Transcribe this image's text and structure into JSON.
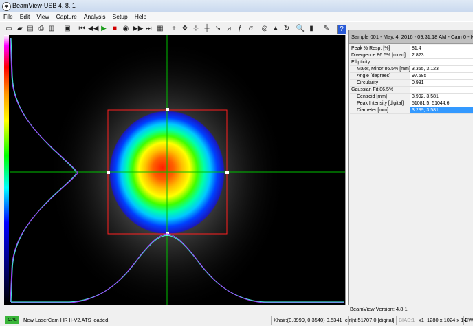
{
  "window": {
    "title": "BeamView-USB 4. 8. 1"
  },
  "menu": [
    "File",
    "Edit",
    "View",
    "Capture",
    "Analysis",
    "Setup",
    "Help"
  ],
  "toolbar": {
    "icons": [
      "new-icon",
      "open-icon",
      "save-icon",
      "print-icon",
      "print-preview-icon",
      "camera-icon",
      "first-frame-icon",
      "previous-frame-icon",
      "play-icon",
      "stop-icon",
      "record-icon",
      "next-frame-icon",
      "last-frame-icon",
      "snapshot-icon",
      "crosshair-icon",
      "move-crosshair-icon",
      "axis-icon",
      "cursor-icon",
      "angle-icon",
      "profile-icon",
      "function-icon",
      "sigma-icon",
      "aperture-icon",
      "3d-view-icon",
      "rotate-icon",
      "zoom-icon",
      "histogram-icon",
      "pen-icon",
      "help-icon"
    ],
    "glyphs": [
      "▭",
      "▰",
      "▤",
      "⎙",
      "▥",
      "▣",
      "⏮",
      "◀◀",
      "▶",
      "■",
      "◉",
      "▶▶",
      "⏭",
      "▦",
      "+",
      "✥",
      "⊹",
      "┼",
      "↘",
      "⩘",
      "ƒ",
      "σ",
      "◎",
      "▲",
      "↻",
      "🔍",
      "▮",
      "✎",
      "?"
    ]
  },
  "colors": {
    "accent": "#3399ff",
    "cal_green": "#3ab53a",
    "crosshair": "#00c000",
    "roi_box": "#ff2020",
    "profile_fit": "#a040ff",
    "profile_data": "#40e0d0"
  },
  "panel": {
    "header": "Sample 001 - May. 4, 2016 - 09:31:18 AM - Cam 0 - N",
    "rows": [
      {
        "label": "Peak % Resp. [%]",
        "value": "81.4",
        "indent": 0,
        "selected": false
      },
      {
        "label": "Divergence 86.5% [mrad]",
        "value": "2.823",
        "indent": 0,
        "selected": false
      },
      {
        "label": "Ellipticity",
        "value": "",
        "indent": 0,
        "selected": false
      },
      {
        "label": "Major, Minor 86.5% [mm]",
        "value": "3.355, 3.123",
        "indent": 1,
        "selected": false
      },
      {
        "label": "Angle [degrees]",
        "value": "97.585",
        "indent": 1,
        "selected": false
      },
      {
        "label": "Circularity",
        "value": "0.931",
        "indent": 1,
        "selected": false
      },
      {
        "label": "Gaussian Fit 86.5%",
        "value": "",
        "indent": 0,
        "selected": false
      },
      {
        "label": "Centroid [mm]",
        "value": "3.992, 3.581",
        "indent": 1,
        "selected": false
      },
      {
        "label": "Peak Intensity [digital]",
        "value": "51081.5, 51044.6",
        "indent": 1,
        "selected": false
      },
      {
        "label": "Diameter [mm]",
        "value": "3.239, 3.581",
        "indent": 1,
        "selected": true
      }
    ],
    "version": "BeamView Version: 4.8.1"
  },
  "status": {
    "cal": "CAL",
    "message": "New LaserCam HR II-V2.ATS loaded.",
    "xhair": "Xhair:(0.3999, 0.3540) 0.5341 [cm]",
    "int": "Int:51707.0 [digital]",
    "bias": "BIAS:1",
    "zoom": "x1",
    "resolution": "1280 x 1024 x 14",
    "mode": "CW"
  }
}
